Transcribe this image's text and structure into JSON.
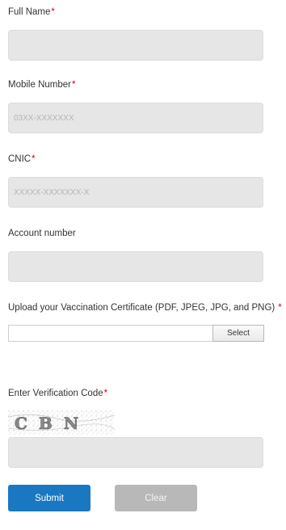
{
  "form": {
    "full_name": {
      "label": "Full Name",
      "required_mark": "*",
      "value": "",
      "placeholder": ""
    },
    "mobile": {
      "label": "Mobile Number",
      "required_mark": "*",
      "value": "",
      "placeholder": "03XX-XXXXXXX"
    },
    "cnic": {
      "label": "CNIC",
      "required_mark": "*",
      "value": "",
      "placeholder": "XXXXX-XXXXXXX-X"
    },
    "account": {
      "label": "Account number",
      "value": "",
      "placeholder": ""
    },
    "upload": {
      "label": "Upload your Vaccination Certificate (PDF, JPEG, JPG, and PNG)",
      "required_mark": "*",
      "button_label": "Select",
      "file_path": ""
    },
    "verification": {
      "label": "Enter Verification Code",
      "required_mark": "*",
      "captcha_text": "CBN",
      "value": "",
      "placeholder": ""
    }
  },
  "buttons": {
    "submit": "Submit",
    "clear": "Clear"
  },
  "colors": {
    "required": "#d0021b",
    "submit_bg": "#1a78c2",
    "clear_bg": "#b8b8b8",
    "field_bg": "#e6e6e6"
  }
}
